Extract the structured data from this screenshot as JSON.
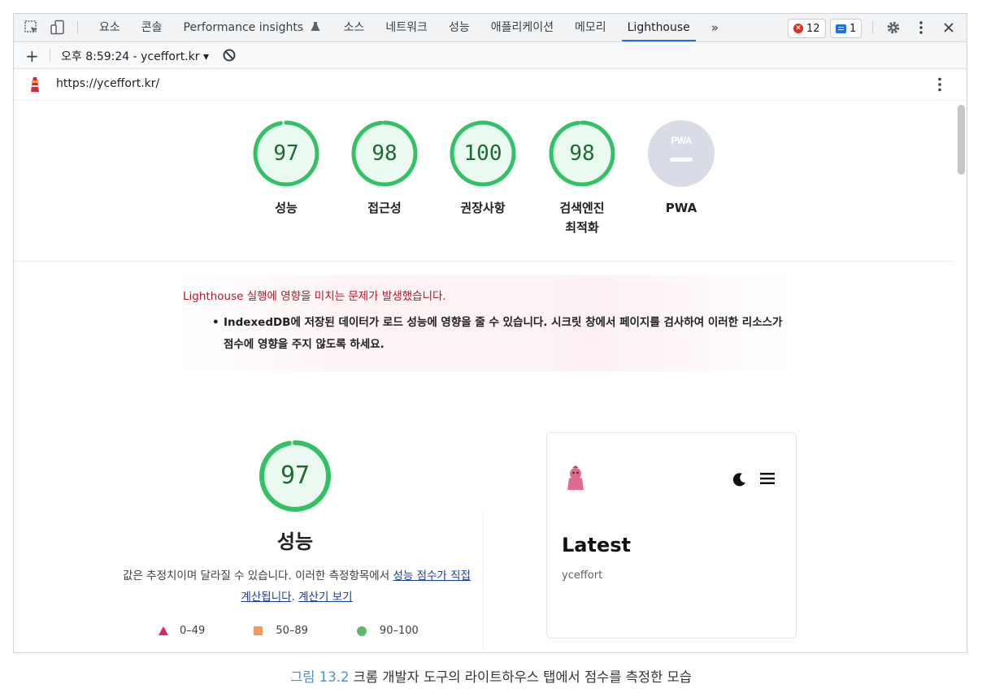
{
  "devtools": {
    "tabs": [
      "요소",
      "콘솔",
      "Performance insights",
      "소스",
      "네트워크",
      "성능",
      "애플리케이션",
      "메모리",
      "Lighthouse"
    ],
    "active_tab": "Lighthouse",
    "more_label": "»",
    "errors_count": "12",
    "messages_count": "1"
  },
  "toolbar": {
    "add_label": "+",
    "report_selector": "오후 8:59:24 - yceffort.kr ▾"
  },
  "url_bar": {
    "url": "https://yceffort.kr/"
  },
  "scores": [
    {
      "value": "97",
      "label": "성능",
      "fraction": 0.97
    },
    {
      "value": "98",
      "label": "접근성",
      "fraction": 0.98
    },
    {
      "value": "100",
      "label": "권장사항",
      "fraction": 1.0
    },
    {
      "value": "98",
      "label": "검색엔진\n최적화",
      "fraction": 0.98
    },
    {
      "value": "PWA",
      "label": "PWA"
    }
  ],
  "warning": {
    "title": "Lighthouse 실행에 영향을 미치는 문제가 발생했습니다.",
    "item": "IndexedDB에 저장된 데이터가 로드 성능에 영향을 줄 수 있습니다. 시크릿 창에서 페이지를 검사하여 이러한 리소스가 점수에 영향을 주지 않도록 하세요."
  },
  "performance": {
    "score": "97",
    "fraction": 0.97,
    "title": "성능",
    "desc_prefix": "값은 추정치이며 달라질 수 있습니다. 이러한 측정항목에서 ",
    "desc_link1": "성능 점수가 직접 계산됩니다",
    "desc_mid": ". ",
    "desc_link2": "계산기 보기",
    "legend": [
      {
        "label": "0–49"
      },
      {
        "label": "50–89"
      },
      {
        "label": "90–100"
      }
    ]
  },
  "preview": {
    "title": "Latest",
    "subtitle": "yceffort"
  },
  "caption": {
    "figure": "그림 13.2",
    "text": " 크롬 개발자 도구의 라이트하우스 탭에서 점수를 측정한 모습"
  },
  "colors": {
    "pass": "#0cce6b",
    "pass_text": "#1b6b2f",
    "accent": "#1a73e8",
    "error": "#d93025"
  }
}
